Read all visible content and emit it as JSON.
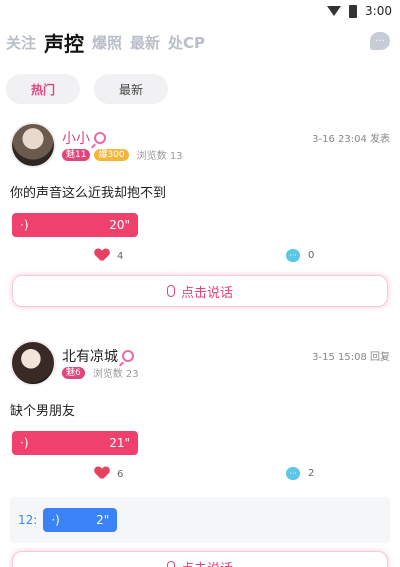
{
  "status_bar": {
    "time": "3:00"
  },
  "nav": {
    "tabs": [
      {
        "label": "关注",
        "active": false
      },
      {
        "label": "声控",
        "active": true
      },
      {
        "label": "爆照",
        "active": false
      },
      {
        "label": "最新",
        "active": false
      },
      {
        "label": "处CP",
        "active": false
      }
    ],
    "message_icon": "chat-icon"
  },
  "filters": [
    {
      "label": "热门",
      "active": true
    },
    {
      "label": "最新",
      "active": false
    }
  ],
  "posts": [
    {
      "username": "小小",
      "gender_icon": "female-icon",
      "charm_badge": "魅11",
      "wealth_badge": "爆300",
      "views": "浏览数 13",
      "time": "3-16 23:04 发表",
      "content": "你的声音这么近我却抱不到",
      "voice": {
        "icon": "·)",
        "duration": "20\""
      },
      "likes": "4",
      "comments": "0",
      "talk_button": "点击说话"
    },
    {
      "username": "北有凉城",
      "gender_icon": "female-icon",
      "charm_badge": "魅6",
      "views": "浏览数 23",
      "time": "3-15 15:08 回复",
      "content": "缺个男朋友",
      "voice": {
        "icon": "·)",
        "duration": "21\""
      },
      "likes": "6",
      "comments": "2",
      "reply": {
        "label": "12:",
        "icon": "·)",
        "duration": "2\""
      },
      "talk_button": "点击说话"
    }
  ],
  "colors": {
    "accent": "#e0457b",
    "voice": "#f0406e",
    "reply_voice": "#3b82f6"
  }
}
